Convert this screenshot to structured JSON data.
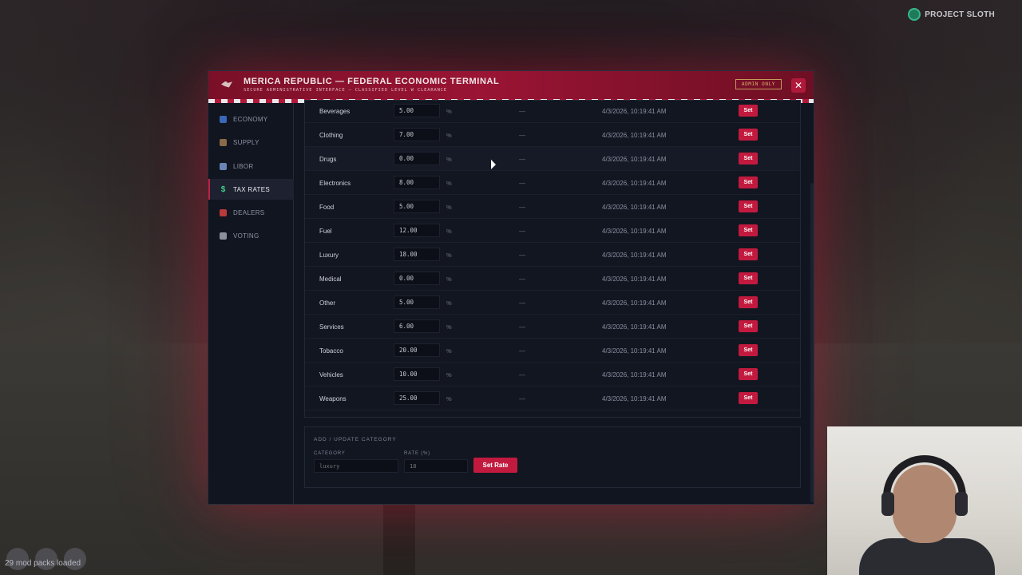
{
  "brand": {
    "name": "PROJECT SLOTH"
  },
  "terminal": {
    "title": "MERICA REPUBLIC — FEDERAL ECONOMIC TERMINAL",
    "subtitle": "SECURE ADMINISTRATIVE INTERFACE — CLASSIFIED LEVEL W CLEARANCE",
    "badge": "ADMIN ONLY",
    "close_label": "✕"
  },
  "sidebar": {
    "items": [
      {
        "label": "ECONOMY",
        "icon": "chart-icon"
      },
      {
        "label": "SUPPLY",
        "icon": "factory-icon"
      },
      {
        "label": "LIBOR",
        "icon": "trend-icon"
      },
      {
        "label": "TAX RATES",
        "icon": "dollar-icon",
        "active": true
      },
      {
        "label": "DEALERS",
        "icon": "car-icon"
      },
      {
        "label": "VOTING",
        "icon": "ballot-icon"
      }
    ]
  },
  "tax_table": {
    "unit": "%",
    "placeholder_dash": "—",
    "set_label": "Set",
    "rows": [
      {
        "category": "Beverages",
        "rate": "5.00",
        "updated": "4/3/2026, 10:19:41 AM"
      },
      {
        "category": "Clothing",
        "rate": "7.00",
        "updated": "4/3/2026, 10:19:41 AM"
      },
      {
        "category": "Drugs",
        "rate": "0.00",
        "updated": "4/3/2026, 10:19:41 AM"
      },
      {
        "category": "Electronics",
        "rate": "8.00",
        "updated": "4/3/2026, 10:19:41 AM"
      },
      {
        "category": "Food",
        "rate": "5.00",
        "updated": "4/3/2026, 10:19:41 AM"
      },
      {
        "category": "Fuel",
        "rate": "12.00",
        "updated": "4/3/2026, 10:19:41 AM"
      },
      {
        "category": "Luxury",
        "rate": "18.00",
        "updated": "4/3/2026, 10:19:41 AM"
      },
      {
        "category": "Medical",
        "rate": "0.00",
        "updated": "4/3/2026, 10:19:41 AM"
      },
      {
        "category": "Other",
        "rate": "5.00",
        "updated": "4/3/2026, 10:19:41 AM"
      },
      {
        "category": "Services",
        "rate": "6.00",
        "updated": "4/3/2026, 10:19:41 AM"
      },
      {
        "category": "Tobacco",
        "rate": "20.00",
        "updated": "4/3/2026, 10:19:41 AM"
      },
      {
        "category": "Vehicles",
        "rate": "10.00",
        "updated": "4/3/2026, 10:19:41 AM"
      },
      {
        "category": "Weapons",
        "rate": "25.00",
        "updated": "4/3/2026, 10:19:41 AM"
      }
    ]
  },
  "add_update": {
    "title": "ADD / UPDATE CATEGORY",
    "category_label": "CATEGORY",
    "category_placeholder": "luxury",
    "rate_label": "RATE (%)",
    "rate_placeholder": "18",
    "submit_label": "Set Rate"
  },
  "status": {
    "mod_packs": "29 mod packs loaded"
  },
  "colors": {
    "accent": "#c21a3e",
    "panel": "#111520",
    "active_icon": "#3ecf8a"
  }
}
